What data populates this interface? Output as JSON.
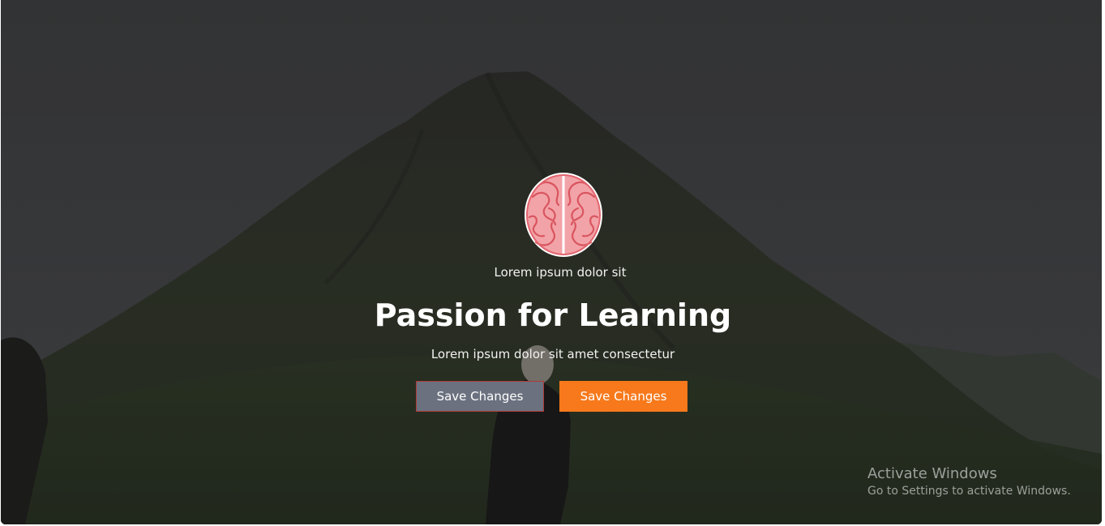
{
  "hero": {
    "eyebrow": "Lorem ipsum dolor sit",
    "title": "Passion for Learning",
    "subtitle": "Lorem ipsum dolor sit amet consectetur",
    "logo_icon": "brain-icon",
    "background_image": "mountain-landscape"
  },
  "actions": {
    "secondary_label": "Save Changes",
    "primary_label": "Save Changes"
  },
  "colors": {
    "secondary_button": "#6b717f",
    "primary_button": "#f7791b",
    "overlay": "#3e4043"
  },
  "os_watermark": {
    "title": "Activate Windows",
    "subtitle": "Go to Settings to activate Windows."
  }
}
